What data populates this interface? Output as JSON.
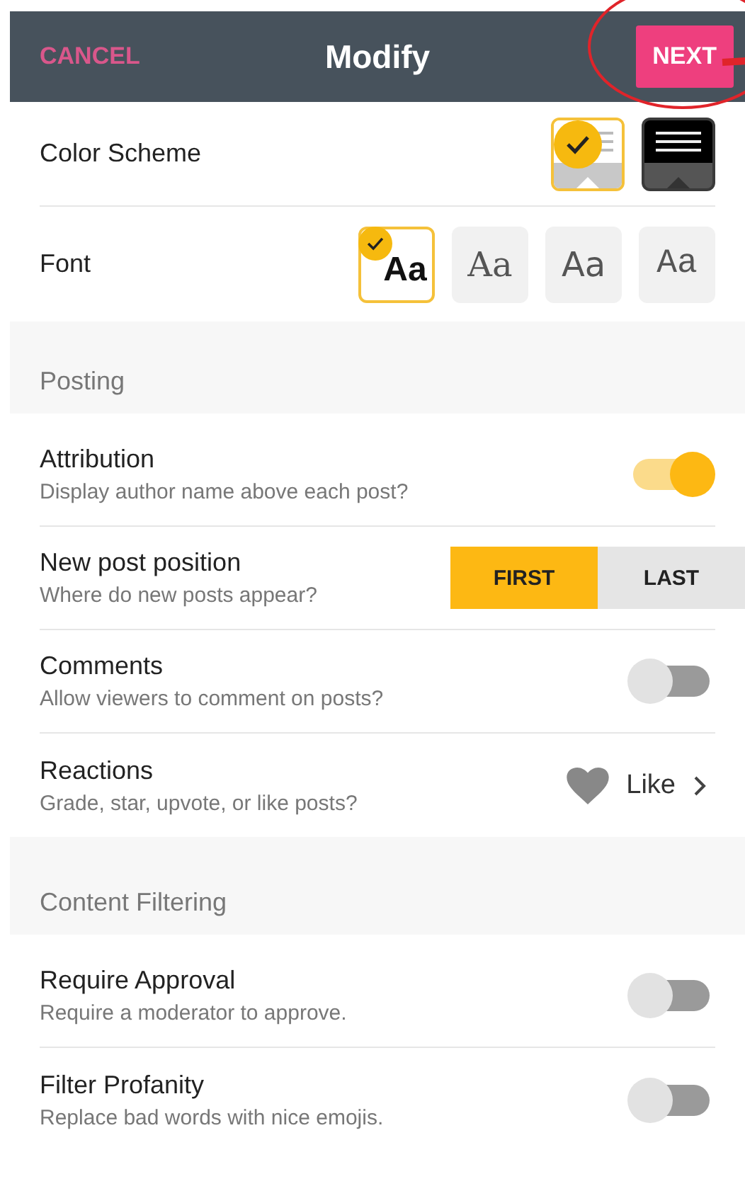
{
  "header": {
    "cancel": "CANCEL",
    "title": "Modify",
    "next": "NEXT",
    "next_highlighted": true
  },
  "appearance": {
    "color_scheme": {
      "label": "Color Scheme",
      "options": [
        {
          "kind": "light",
          "selected": true
        },
        {
          "kind": "dark",
          "selected": false
        }
      ]
    },
    "font": {
      "label": "Font",
      "options": [
        {
          "kind": "sans",
          "text": "Aa",
          "selected": true
        },
        {
          "kind": "serif",
          "text": "Aa",
          "selected": false
        },
        {
          "kind": "round",
          "text": "Aa",
          "selected": false
        },
        {
          "kind": "mono",
          "text": "Aa",
          "selected": false
        }
      ]
    }
  },
  "sections": [
    {
      "title": "Posting",
      "rows": [
        {
          "kind": "toggle",
          "title": "Attribution",
          "subtitle": "Display author name above each post?",
          "on": true
        },
        {
          "kind": "segmented",
          "title": "New post position",
          "subtitle": "Where do new posts appear?",
          "options": [
            {
              "label": "FIRST",
              "selected": true
            },
            {
              "label": "LAST",
              "selected": false
            }
          ]
        },
        {
          "kind": "toggle",
          "title": "Comments",
          "subtitle": "Allow viewers to comment on posts?",
          "on": false
        },
        {
          "kind": "link",
          "title": "Reactions",
          "subtitle": "Grade, star, upvote, or like posts?",
          "value": "Like"
        }
      ]
    },
    {
      "title": "Content Filtering",
      "rows": [
        {
          "kind": "toggle",
          "title": "Require Approval",
          "subtitle": "Require a moderator to approve.",
          "on": false
        },
        {
          "kind": "toggle",
          "title": "Filter Profanity",
          "subtitle": "Replace bad words with nice emojis.",
          "on": false
        }
      ]
    }
  ]
}
